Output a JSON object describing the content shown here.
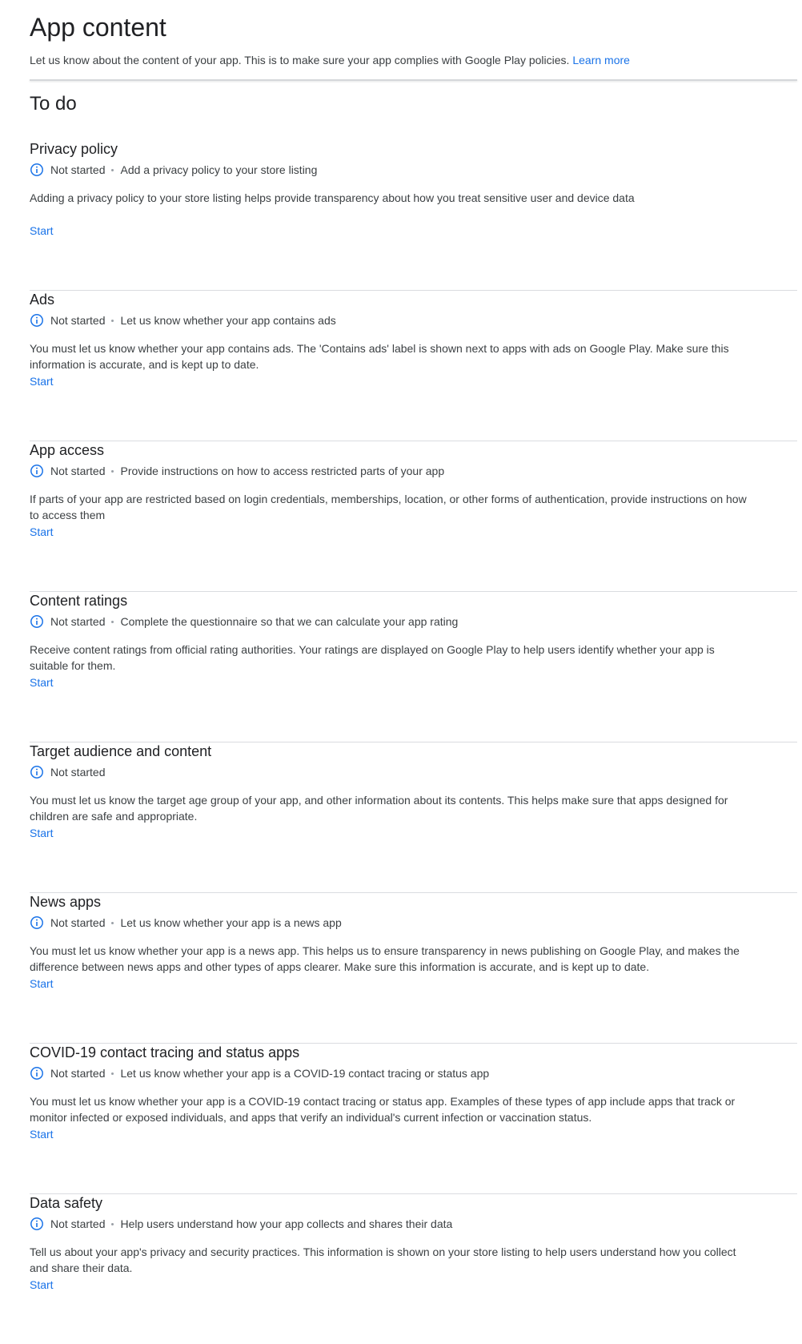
{
  "header": {
    "title": "App content",
    "description": "Let us know about the content of your app. This is to make sure your app complies with Google Play policies.",
    "learn_more": "Learn more"
  },
  "todo": {
    "title": "To do"
  },
  "colors": {
    "accent": "#1a73e8",
    "info_icon": "#1a73e8",
    "text_primary": "#202124",
    "text_secondary": "#3c4043",
    "divider": "#dadce0"
  },
  "tasks": [
    {
      "title": "Privacy policy",
      "status": "Not started",
      "summary": "Add a privacy policy to your store listing",
      "description": "Adding a privacy policy to your store listing helps provide transparency about how you treat sensitive user and device data",
      "action": "Start",
      "icon": "info-icon"
    },
    {
      "title": "Ads",
      "status": "Not started",
      "summary": "Let us know whether your app contains ads",
      "description": "You must let us know whether your app contains ads. The 'Contains ads' label is shown next to apps with ads on Google Play. Make sure this information is accurate, and is kept up to date.",
      "action": "Start",
      "icon": "info-icon"
    },
    {
      "title": "App access",
      "status": "Not started",
      "summary": "Provide instructions on how to access restricted parts of your app",
      "description": "If parts of your app are restricted based on login credentials, memberships, location, or other forms of authentication, provide instructions on how to access them",
      "action": "Start",
      "icon": "info-icon"
    },
    {
      "title": "Content ratings",
      "status": "Not started",
      "summary": "Complete the questionnaire so that we can calculate your app rating",
      "description": "Receive content ratings from official rating authorities. Your ratings are displayed on Google Play to help users identify whether your app is suitable for them.",
      "action": "Start",
      "icon": "info-icon"
    },
    {
      "title": "Target audience and content",
      "status": "Not started",
      "summary": "",
      "description": "You must let us know the target age group of your app, and other information about its contents. This helps make sure that apps designed for children are safe and appropriate.",
      "action": "Start",
      "icon": "info-icon"
    },
    {
      "title": "News apps",
      "status": "Not started",
      "summary": "Let us know whether your app is a news app",
      "description": "You must let us know whether your app is a news app. This helps us to ensure transparency in news publishing on Google Play, and makes the difference between news apps and other types of apps clearer. Make sure this information is accurate, and is kept up to date.",
      "action": "Start",
      "icon": "info-icon"
    },
    {
      "title": "COVID-19 contact tracing and status apps",
      "status": "Not started",
      "summary": "Let us know whether your app is a COVID-19 contact tracing or status app",
      "description": "You must let us know whether your app is a COVID-19 contact tracing or status app. Examples of these types of app include apps that track or monitor infected or exposed individuals, and apps that verify an individual's current infection or vaccination status.",
      "action": "Start",
      "icon": "info-icon"
    },
    {
      "title": "Data safety",
      "status": "Not started",
      "summary": "Help users understand how your app collects and shares their data",
      "description": "Tell us about your app's privacy and security practices. This information is shown on your store listing to help users understand how you collect and share their data.",
      "action": "Start",
      "icon": "info-icon"
    }
  ]
}
